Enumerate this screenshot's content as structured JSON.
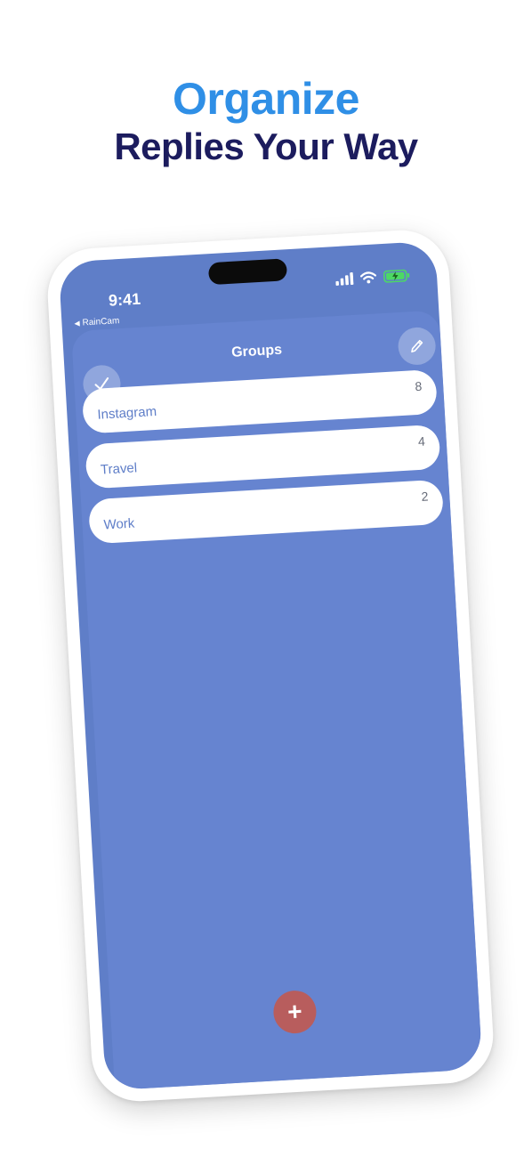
{
  "headline": {
    "line1": "Organize",
    "line2": "Replies Your Way"
  },
  "status_bar": {
    "time": "9:41",
    "back_app": "RainCam",
    "icons": [
      "cellular-signal-icon",
      "wifi-icon",
      "battery-charging-icon"
    ]
  },
  "groups_sheet": {
    "title": "Groups",
    "check_icon": "checkmark-icon",
    "edit_icon": "pencil-icon",
    "items": [
      {
        "name": "Instagram",
        "count": "8"
      },
      {
        "name": "Travel",
        "count": "4"
      },
      {
        "name": "Work",
        "count": "2"
      }
    ],
    "add_label": "+"
  },
  "colors": {
    "headline_blue": "#2f8fe6",
    "headline_navy": "#1c1c5e",
    "screen_bg": "#5f7ec8",
    "sheet_bg": "#6684d0",
    "add_button": "#b85d5d",
    "battery_green": "#4cd964"
  }
}
